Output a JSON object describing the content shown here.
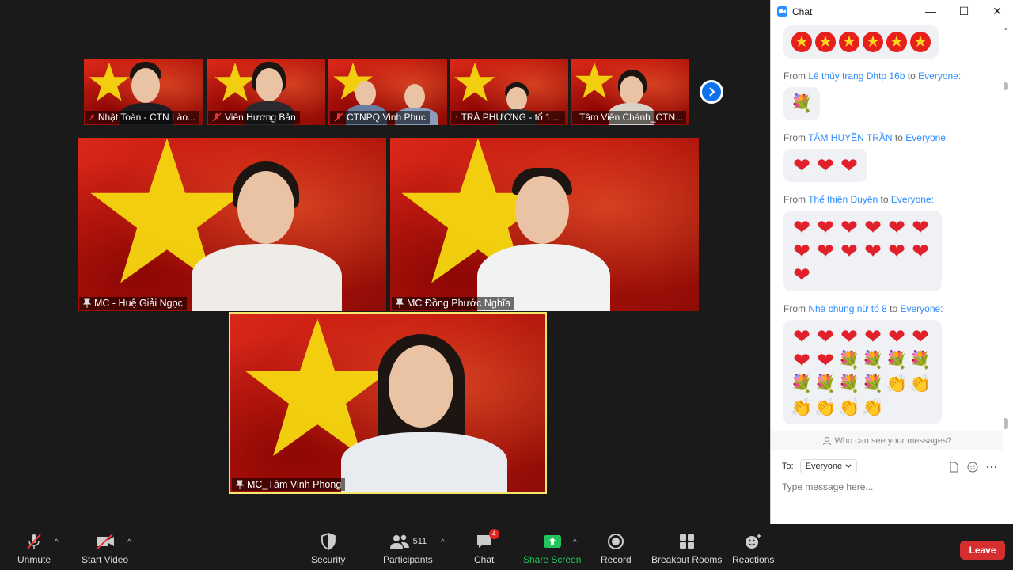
{
  "gallery": {
    "thumbnails": [
      {
        "name": "Nhật Toàn - CTN Lào...",
        "muted": true
      },
      {
        "name": "Viên Hương Bản",
        "muted": true
      },
      {
        "name": "CTNPQ Vinh Phuc",
        "muted": true
      },
      {
        "name": "TRÀ PHƯƠNG - tổ 1 ...",
        "muted": true
      },
      {
        "name": "Tâm Viên Chánh_CTN...",
        "muted": true
      }
    ],
    "main_tiles": [
      {
        "name": "MC - Huệ Giải Ngọc",
        "pinned": true
      },
      {
        "name": "MC Đồng Phước Nghĩa",
        "pinned": true
      },
      {
        "name": "MC_Tâm Vinh Phong",
        "pinned": true,
        "active_speaker": true
      }
    ],
    "next_page_icon": "chevron-right-icon"
  },
  "chat": {
    "title": "Chat",
    "window_controls": {
      "minimize": "—",
      "maximize": "☐",
      "close": "✕"
    },
    "messages": [
      {
        "from": "",
        "to": "",
        "content": [
          "star",
          "star",
          "star",
          "star",
          "star",
          "star"
        ]
      },
      {
        "from": "Lê thùy trang Dhtp 16b",
        "to": "Everyone:",
        "content": [
          "bouquet"
        ]
      },
      {
        "from": "TÂM HUYỀN TRẦN",
        "to": "Everyone:",
        "content": [
          "heart",
          "heart",
          "heart"
        ]
      },
      {
        "from": "Thể thiện Duyên",
        "to": "Everyone:",
        "content": [
          "heart",
          "heart",
          "heart",
          "heart",
          "heart",
          "heart",
          "heart",
          "heart",
          "heart",
          "heart",
          "heart",
          "heart",
          "heart"
        ]
      },
      {
        "from": "Nhà chung nữ tổ 8",
        "to": "Everyone:",
        "content": [
          "heart",
          "heart",
          "heart",
          "heart",
          "heart",
          "heart",
          "heart",
          "heart",
          "bouquet",
          "bouquet",
          "bouquet",
          "bouquet",
          "bouquet",
          "bouquet",
          "bouquet",
          "bouquet",
          "clap",
          "clap",
          "clap",
          "clap",
          "clap",
          "clap"
        ]
      }
    ],
    "from_word": "From",
    "to_word": "to",
    "who_can_see": "Who can see your messages?",
    "to_label": "To:",
    "recipient": "Everyone",
    "input_placeholder": "Type message here..."
  },
  "toolbar": {
    "unmute": "Unmute",
    "start_video": "Start Video",
    "security": "Security",
    "participants": "Participants",
    "participants_count": "511",
    "chat": "Chat",
    "chat_badge": "4",
    "share_screen": "Share Screen",
    "record": "Record",
    "breakout_rooms": "Breakout Rooms",
    "reactions": "Reactions",
    "leave": "Leave"
  },
  "colors": {
    "accent_blue": "#2d8cff",
    "share_green": "#23c45e",
    "leave_red": "#d42e2e",
    "active_border": "#f5e86b"
  }
}
